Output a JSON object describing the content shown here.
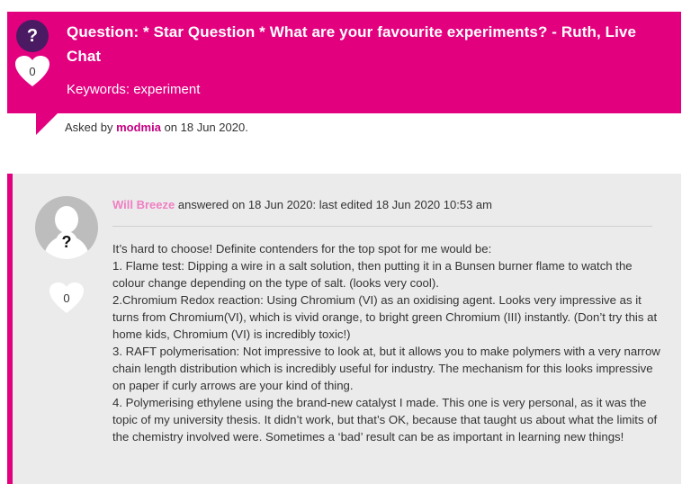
{
  "question": {
    "title": "Question: * Star Question * What are your favourite experiments? - Ruth, Live Chat",
    "keywords": "Keywords: experiment",
    "badge_symbol": "?",
    "likes": "0",
    "asked_prefix": "Asked by",
    "asked_user": "modmia",
    "asked_suffix": "on 18 Jun 2020."
  },
  "answer": {
    "author": "Will Breeze",
    "meta": "answered on 18 Jun 2020: last edited 18 Jun 2020 10:53 am",
    "likes": "0",
    "avatar_symbol": "?",
    "lines": [
      "It’s hard to choose! Definite contenders for the top spot for me would be:",
      "1. Flame test: Dipping a wire in a salt solution, then putting it in a Bunsen burner flame to watch the colour change depending on the type of salt. (looks very cool).",
      "2.Chromium Redox reaction: Using Chromium (VI) as an oxidising agent. Looks very impressive as it turns from Chromium(VI), which is vivid orange, to bright green Chromium (III) instantly. (Don’t try this at home kids, Chromium (VI) is incredibly toxic!)",
      "3. RAFT polymerisation: Not impressive to look at, but it allows you to make polymers with a very narrow chain length distribution which is incredibly useful for industry. The mechanism for this looks impressive on paper if curly arrows are your kind of thing.",
      "4. Polymerising ethylene using the brand-new catalyst I made. This one is very personal, as it was the topic of my university thesis. It didn’t work, but that’s OK, because that taught us about what the limits of the chemistry involved were. Sometimes a ‘bad’ result can be as important in learning new things!"
    ]
  },
  "colors": {
    "accent": "#e3007f",
    "badge": "#4a1a63",
    "author": "#ef7fc2",
    "panel": "#ebebeb"
  },
  "icons": {
    "question_badge": "question-mark-icon",
    "likes": "heart-icon",
    "avatar": "user-avatar-icon"
  }
}
